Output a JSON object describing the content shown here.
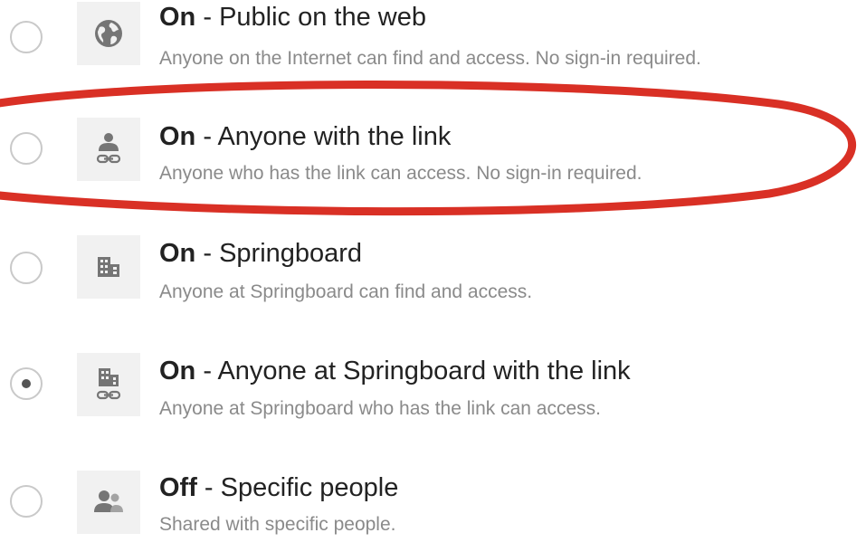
{
  "options": [
    {
      "state": "On",
      "separator": " - ",
      "title": "Public on the web",
      "description": "Anyone on the Internet can find and access. No sign-in required.",
      "icon": "globe-icon",
      "selected": false
    },
    {
      "state": "On",
      "separator": " - ",
      "title": "Anyone with the link",
      "description": "Anyone who has the link can access. No sign-in required.",
      "icon": "person-link-icon",
      "selected": false
    },
    {
      "state": "On",
      "separator": " - ",
      "title": "Springboard",
      "description": "Anyone at Springboard can find and access.",
      "icon": "building-icon",
      "selected": false
    },
    {
      "state": "On",
      "separator": " - ",
      "title": "Anyone at Springboard with the link",
      "description": "Anyone at Springboard who has the link can access.",
      "icon": "building-link-icon",
      "selected": true
    },
    {
      "state": "Off",
      "separator": " - ",
      "title": "Specific people",
      "description": "Shared with specific people.",
      "icon": "people-icon",
      "selected": false
    }
  ],
  "colors": {
    "highlight": "#d93025",
    "icon": "#757575",
    "radio_border": "#c9c9c9",
    "radio_dot": "#555555",
    "title_text": "#222222",
    "description_text": "#8a8a8a"
  }
}
